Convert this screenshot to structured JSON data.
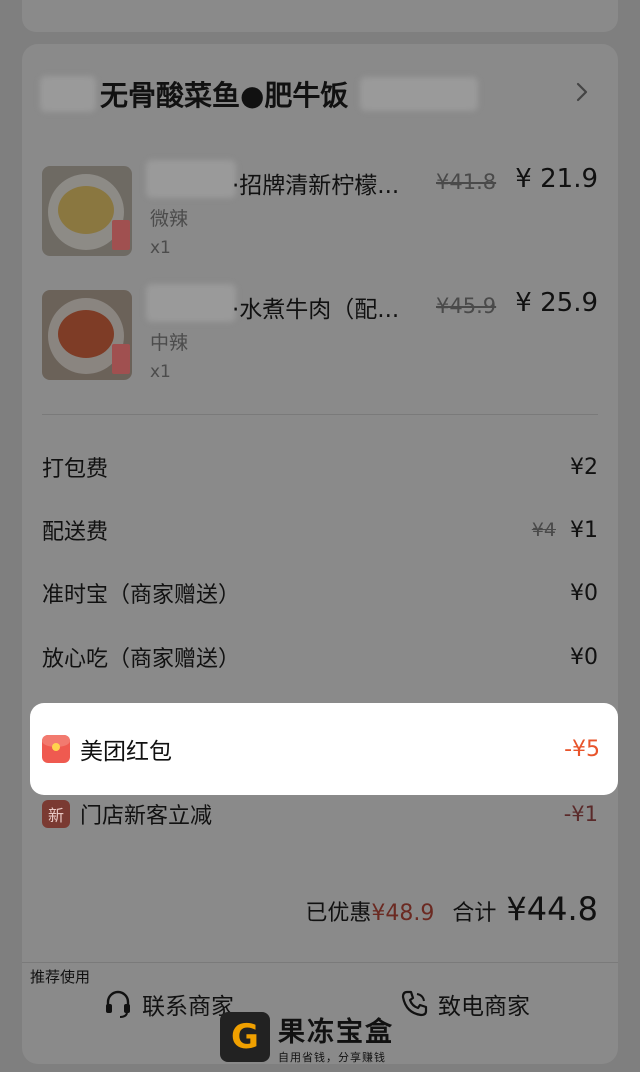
{
  "shop": {
    "name": "无骨酸菜鱼●肥牛饭"
  },
  "items": [
    {
      "name": "·招牌清新柠檬...",
      "spec": "微辣",
      "qty": "x1",
      "original_price": "¥41.8",
      "price": "¥ 21.9"
    },
    {
      "name": "·水煮牛肉（配...",
      "spec": "中辣",
      "qty": "x1",
      "original_price": "¥45.9",
      "price": "¥ 25.9"
    }
  ],
  "fees": [
    {
      "label": "打包费",
      "original": "",
      "value": "¥2"
    },
    {
      "label": "配送费",
      "original": "¥4",
      "value": "¥1"
    },
    {
      "label": "准时宝（商家赠送）",
      "original": "",
      "value": "¥0"
    },
    {
      "label": "放心吃（商家赠送）",
      "original": "",
      "value": "¥0"
    }
  ],
  "promos": [
    {
      "label": "美团红包",
      "value": "-¥5"
    },
    {
      "label": "门店新客立减",
      "icon_text": "新",
      "value": "-¥1"
    }
  ],
  "summary": {
    "discount_label": "已优惠",
    "discount_value": "¥48.9",
    "total_label": "合计",
    "total_value": "¥44.8"
  },
  "recommend_label": "推荐使用",
  "actions": {
    "contact": "联系商家",
    "call": "致电商家"
  },
  "watermark": {
    "logo": "G",
    "title": "果冻宝盒",
    "subtitle": "自用省钱，分享赚钱"
  },
  "colors": {
    "overlay_bg": "#7f7f7f",
    "highlight_bg": "#ffffff",
    "discount_red": "#e8542b",
    "redpack": "#ef5a50"
  }
}
